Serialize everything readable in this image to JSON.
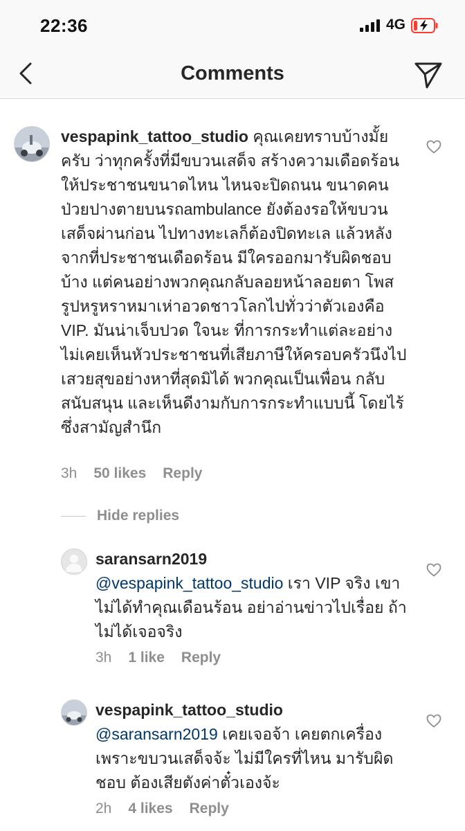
{
  "status_bar": {
    "time": "22:36",
    "network": "4G"
  },
  "nav": {
    "title": "Comments"
  },
  "comments": [
    {
      "username": "vespapink_tattoo_studio",
      "text": " คุณเคยทราบบ้างมั้ยครับ ว่าทุกครั้งที่มีขบวนเสด็จ สร้างความเดือดร้อนให้ประชาชนขนาดไหน ไหนจะปิดถนน ขนาดคนป่วยปางตายบนรถambulance ยังต้องรอให้ขบวนเสด็จผ่านก่อน ไปทางทะเลก็ต้องปิดทะเล แล้วหลังจากที่ประชาชนเดือดร้อน มีใครออกมารับผิดชอบบ้าง แต่คนอย่างพวกคุณกลับลอยหน้าลอยตา โพสรูปหรูหราหมาเห่าอวดชาวโลกไปทั่วว่าตัวเองคือ VIP. มันน่าเจ็บปวด ใจนะ ที่การกระทำแต่ละอย่างไม่เคยเห็นหัวประชาชนที่เสียภาษีให้ครอบครัวนึงไปเสวยสุขอย่างหาที่สุดมิได้ พวกคุณเป็นเพื่อน กลับสนับสนุน และเห็นดีงามกับการกระทำแบบนี้ โดยไร้ซึ่งสามัญสำนึก",
      "time": "3h",
      "likes": "50 likes",
      "reply": "Reply"
    },
    {
      "username": "saransarn2019",
      "mention": "@vespapink_tattoo_studio",
      "text": " เรา VIP จริง เขาไม่ได้ทำคุณเดือนร้อน อย่าอ่านข่าวไปเรื่อย ถ้าไม่ได้เจอจริง",
      "time": "3h",
      "likes": "1 like",
      "reply": "Reply"
    },
    {
      "username": "vespapink_tattoo_studio",
      "mention": "@saransarn2019",
      "text": " เคยเจอจ้า เคยตกเครื่องเพราะขบวนเสด็จจ้ะ ไม่มีใครที่ไหน มารับผิดชอบ ต้องเสียตังค่าตั๋วเองจ้ะ",
      "time": "2h",
      "likes": "4 likes",
      "reply": "Reply"
    }
  ],
  "hide_replies": "Hide replies",
  "icons": {
    "back": "chevron-left-icon",
    "send": "paper-plane-icon",
    "like": "heart-outline-icon",
    "signal": "cellular-signal-icon",
    "battery": "battery-low-icon"
  },
  "colors": {
    "mention": "#00376b",
    "meta": "#8e8e8e",
    "battery_low": "#ff3b30"
  }
}
